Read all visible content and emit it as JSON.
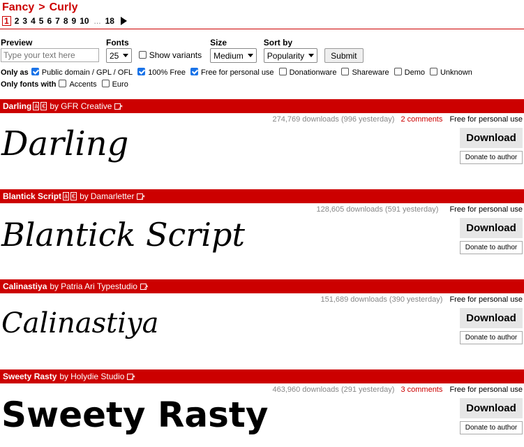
{
  "breadcrumb": {
    "parent": "Fancy",
    "separator": ">",
    "current": "Curly"
  },
  "pager": {
    "current": "1",
    "pages": [
      "2",
      "3",
      "4",
      "5",
      "6",
      "7",
      "8",
      "9",
      "10"
    ],
    "ellipsis": "...",
    "last": "18"
  },
  "controls": {
    "preview_label": "Preview",
    "preview_placeholder": "Type your text here",
    "fonts_label": "Fonts",
    "fonts_value": "25",
    "show_variants_label": "Show variants",
    "size_label": "Size",
    "size_value": "Medium",
    "sort_label": "Sort by",
    "sort_value": "Popularity",
    "submit_label": "Submit"
  },
  "filters": {
    "only_as_label": "Only as",
    "licenses": [
      {
        "label": "Public domain / GPL / OFL",
        "checked": true
      },
      {
        "label": "100% Free",
        "checked": true
      },
      {
        "label": "Free for personal use",
        "checked": true
      },
      {
        "label": "Donationware",
        "checked": false
      },
      {
        "label": "Shareware",
        "checked": false
      },
      {
        "label": "Demo",
        "checked": false
      },
      {
        "label": "Unknown",
        "checked": false
      }
    ],
    "only_fonts_with_label": "Only fonts with",
    "features": [
      {
        "label": "Accents",
        "checked": false
      },
      {
        "label": "Euro",
        "checked": false
      }
    ]
  },
  "fonts": [
    {
      "name": "Darling",
      "tags": [
        "ä",
        "€"
      ],
      "by": "by",
      "author": "GFR Creative",
      "downloads": "274,769 downloads (996 yesterday)",
      "comments": "2 comments",
      "license": "Free for personal use",
      "download_label": "Download",
      "donate_label": "Donate to author",
      "preview_text": "Darling"
    },
    {
      "name": "Blantick Script",
      "tags": [
        "ä",
        "€"
      ],
      "by": "by",
      "author": "Damarletter",
      "downloads": "128,605 downloads (591 yesterday)",
      "comments": "",
      "license": "Free for personal use",
      "download_label": "Download",
      "donate_label": "Donate to author",
      "preview_text": "Blantick Script"
    },
    {
      "name": "Calinastiya",
      "tags": [],
      "by": "by",
      "author": "Patria Ari Typestudio",
      "downloads": "151,689 downloads (390 yesterday)",
      "comments": "",
      "license": "Free for personal use",
      "download_label": "Download",
      "donate_label": "Donate to author",
      "preview_text": "Calinastiya"
    },
    {
      "name": "Sweety Rasty",
      "tags": [],
      "by": "by",
      "author": "Holydie Studio",
      "downloads": "463,960 downloads (291 yesterday)",
      "comments": "3 comments",
      "license": "Free for personal use",
      "download_label": "Download",
      "donate_label": "Donate to author",
      "preview_text": "Sweety Rasty"
    }
  ],
  "colors": {
    "accent": "#cc0000",
    "download_bg": "#e6e6e6",
    "checkbox_checked": "#1a73e8"
  },
  "icons": [
    "next-arrow-icon",
    "external-link-icon",
    "select-caret-icon"
  ]
}
